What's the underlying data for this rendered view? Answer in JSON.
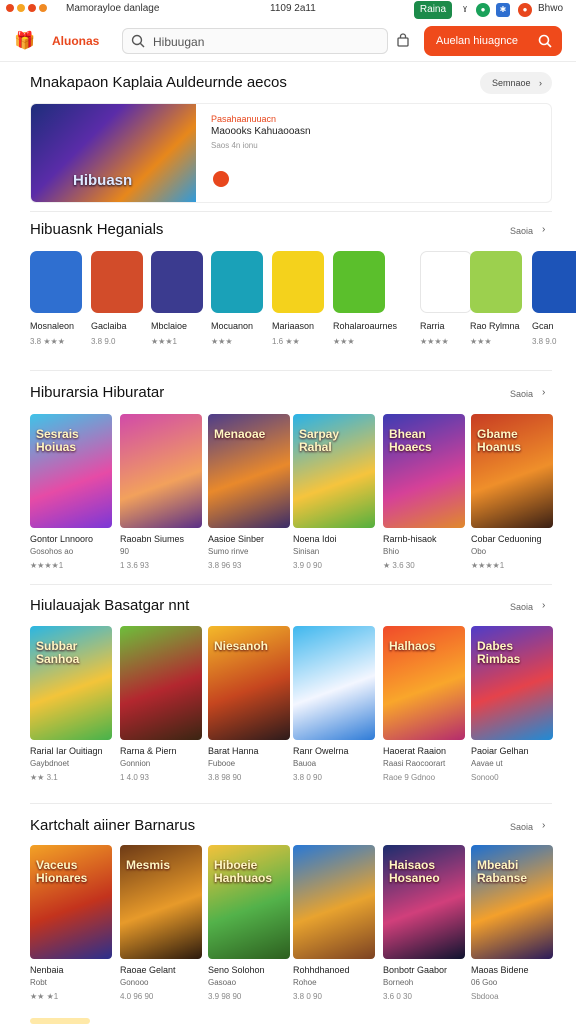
{
  "topbar": {
    "title": "Mamorayloe danlage",
    "clock": "1109 2a11",
    "badge": "Raina",
    "right_label": "Bhwo",
    "colors": {
      "dot1": "#e8471d",
      "dot2": "#f5a623",
      "dot3": "#e8471d",
      "dot4": "#f08a24",
      "badge_bg": "#1c8b4a"
    }
  },
  "header": {
    "logo": "Aluonas",
    "search_placeholder": "Hibuugan",
    "cta_label": "Auelan hiuagnce",
    "accent": "#ef4a1b"
  },
  "featured": {
    "title": "Mnakapaon Kaplaia Auldeurnde aecos",
    "see_label": "Semnaoe",
    "image_caption": "Hibuasn",
    "line1": "Pasahaanuuacn",
    "line2": "Maoooks Kahuaooasn",
    "line3": "Saos 4n ionu"
  },
  "section_icons": {
    "title": "Hibuasnk Heganials",
    "see_label": "Saoia",
    "items": [
      {
        "name": "Mosnaleon",
        "rating": "3.8 ★★★",
        "bg": "#2f6fd0"
      },
      {
        "name": "Gaclaiba",
        "rating": "3.8 9.0",
        "bg": "#d24c2a"
      },
      {
        "name": "Mbclaioe",
        "rating": "★★★1",
        "bg": "#3b3b8f"
      },
      {
        "name": "Mocuanon",
        "rating": "★★★",
        "bg": "#1aa1b8"
      },
      {
        "name": "Mariaason",
        "rating": "1.6 ★★",
        "bg": "#f4d21c"
      },
      {
        "name": "Rohalaroaurnes",
        "rating": "★★★",
        "bg": "#5bbf2c"
      },
      {
        "name": "Rarria",
        "rating": "★★★★",
        "bg": "#ffffff"
      },
      {
        "name": "Rao Rylmna",
        "rating": "★★★",
        "bg": "#9cd04e"
      },
      {
        "name": "Gcan",
        "rating": "3.8 9.0",
        "bg": "#1d54b8"
      }
    ]
  },
  "section_a": {
    "title": "Hiburarsia Hiburatar",
    "see_label": "Saoia",
    "cards": [
      {
        "art": "Sesrais Hoiuas",
        "name": "Gontor Lnnooro",
        "sub": "Gosohos ao",
        "rating": "★★★★1",
        "bg": "linear-gradient(160deg,#3fc3e8,#e64ba6 60%,#7b37d6)"
      },
      {
        "art": "",
        "name": "Raoabn Siumes",
        "sub": "90",
        "rating": "1 3.6 93",
        "bg": "linear-gradient(160deg,#d14aa9,#f2a15c 60%,#5a2f86)"
      },
      {
        "art": "Menaoae",
        "name": "Aasioe Sinber",
        "sub": "Sumo rinve",
        "rating": "3.8 96 93",
        "bg": "linear-gradient(160deg,#4d3d8a,#e9892b 55%,#3b2c68)"
      },
      {
        "art": "Sarpay Rahal",
        "name": "Noena Idoi",
        "sub": "Sinisan",
        "rating": "3.9 0 90",
        "bg": "linear-gradient(160deg,#29b2e8,#f6c43d 60%,#54b03e)"
      },
      {
        "art": "Bhean Hoaecs",
        "name": "Rarnb-hisaok",
        "sub": "Bhio",
        "rating": "★ 3.6 30",
        "bg": "linear-gradient(160deg,#3d3bb3,#d54198 60%,#e0892c)"
      },
      {
        "art": "Gbame Hoanus",
        "name": "Cobar Ceduoning",
        "sub": "Obo",
        "rating": "★★★★1",
        "bg": "linear-gradient(160deg,#c73c23,#ef8f2a 55%,#3a1f14)"
      }
    ]
  },
  "section_b": {
    "title": "Hiulauajak Basatgar nnt",
    "see_label": "Saoia",
    "cards": [
      {
        "art": "Subbar Sanhoa",
        "name": "Rarial Iar Ouitiagn",
        "sub": "Gaybdnoet",
        "rating": "★★ 3.1",
        "bg": "linear-gradient(160deg,#2bb6e3,#f3c43a 55%,#46b24b)"
      },
      {
        "art": "",
        "name": "Rarna & Piern",
        "sub": "Gonnion",
        "rating": "1 4.0 93",
        "bg": "linear-gradient(160deg,#6dbf3b,#b3272f 55%,#3a2512)"
      },
      {
        "art": "Niesanoh",
        "name": "Barat Hanna",
        "sub": "Fubooe",
        "rating": "3.8 98 90",
        "bg": "linear-gradient(160deg,#f4b92a,#c6461f 55%,#2d1b1b)"
      },
      {
        "art": "",
        "name": "Ranr Owelrna",
        "sub": "Bauoa",
        "rating": "3.8 0 90",
        "bg": "linear-gradient(160deg,#3fb7ee,#f3f6ff 55%,#2e7bd7)"
      },
      {
        "art": "Halhaos",
        "name": "Haoerat Raaion",
        "sub": "Raasi Raocoorart",
        "rating": "Raoe 9 Gdnoo",
        "bg": "linear-gradient(160deg,#f04b2a,#f9a62b 55%,#b42b6d)"
      },
      {
        "art": "Dabes Rimbas",
        "name": "Paoiar Gelhan",
        "sub": "Aavae ut",
        "rating": "Sonoo0",
        "bg": "linear-gradient(160deg,#4f3cc8,#e5424b 55%,#1f8bd6)"
      }
    ]
  },
  "section_c": {
    "title": "Kartchalt aiiner Barnarus",
    "see_label": "Saoia",
    "cards": [
      {
        "art": "Vaceus Hionares",
        "name": "Nenbaia",
        "sub": "Robt",
        "rating": "★★ ★1",
        "bg": "linear-gradient(160deg,#f3a226,#c3331d 55%,#2b2f8d)"
      },
      {
        "art": "Mesmis",
        "name": "Raoae Gelant",
        "sub": "Gonooo",
        "rating": "4.0 96 90",
        "bg": "linear-gradient(160deg,#6d3a16,#e79a2a 55%,#2c1a0d)"
      },
      {
        "art": "Hiboeie Hanhuaos",
        "name": "Seno Solohon",
        "sub": "Gasoao",
        "rating": "3.9 98 90",
        "bg": "linear-gradient(160deg,#f3c23b,#53b24a 55%,#2d5f1f)"
      },
      {
        "art": "",
        "name": "Rohhdhanoed",
        "sub": "Rohoe",
        "rating": "3.8 0 90",
        "bg": "linear-gradient(160deg,#2878d6,#e8a32f 55%,#7c4222)"
      },
      {
        "art": "Haisaos Hosaneo",
        "name": "Bonbotr Gaabor",
        "sub": "Borneoh",
        "rating": "3.6 0 30",
        "bg": "linear-gradient(160deg,#1c2d6e,#d13f7b 55%,#0f1430)"
      },
      {
        "art": "Mbeabi Rabanse",
        "name": "Maoas Bidene",
        "sub": "06 Goo",
        "rating": "Sbdooa",
        "bg": "linear-gradient(160deg,#1d6fd1,#f4a02b 55%,#2b1b5a)"
      }
    ]
  }
}
